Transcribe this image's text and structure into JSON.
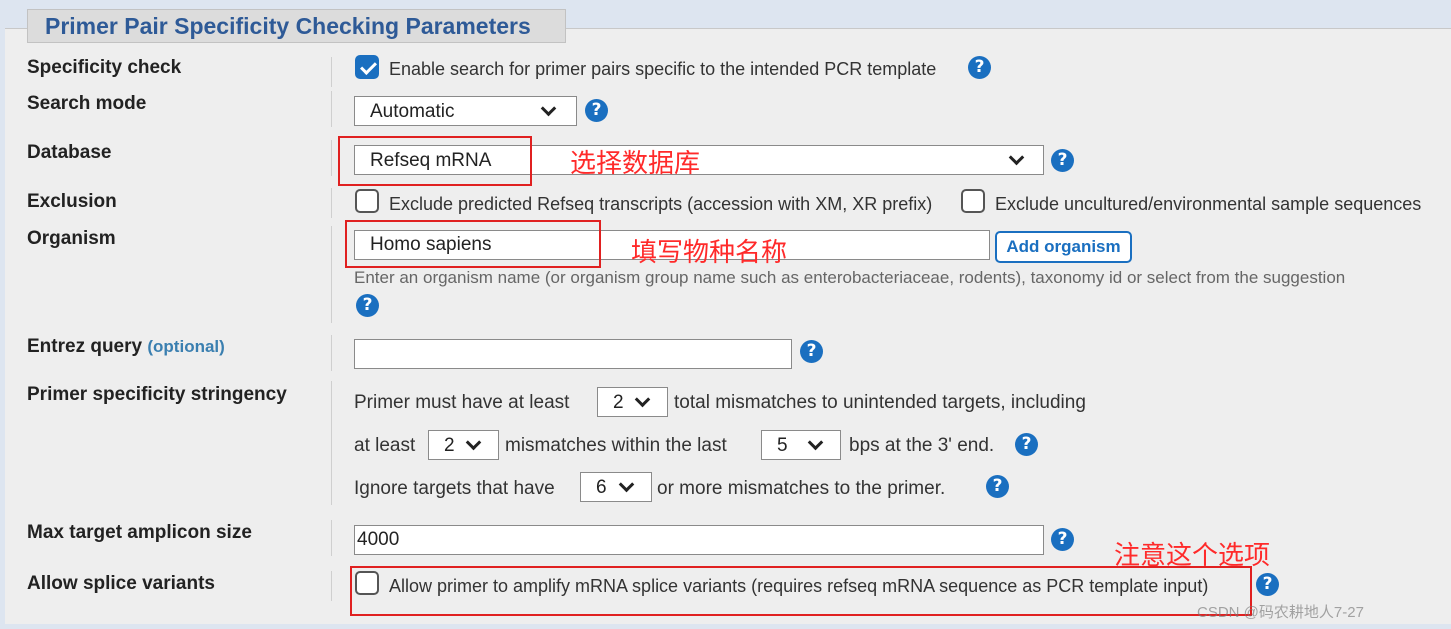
{
  "section_title": "Primer Pair Specificity Checking Parameters",
  "specificity": {
    "label": "Specificity check",
    "checked": true,
    "text": "Enable search for primer pairs specific to the intended PCR template"
  },
  "search_mode": {
    "label": "Search mode",
    "value": "Automatic"
  },
  "database": {
    "label": "Database",
    "value": "Refseq mRNA",
    "annotation": "选择数据库"
  },
  "exclusion": {
    "label": "Exclusion",
    "option1": "Exclude predicted Refseq transcripts (accession with XM, XR prefix)",
    "option1_checked": false,
    "option2": "Exclude uncultured/environmental sample sequences",
    "option2_checked": false
  },
  "organism": {
    "label": "Organism",
    "value": "Homo sapiens",
    "add_button": "Add organism",
    "hint": "Enter an organism name (or organism group name such as enterobacteriaceae, rodents), taxonomy id or select from the suggestion",
    "annotation": "填写物种名称"
  },
  "entrez": {
    "label": "Entrez query",
    "optional": "(optional)",
    "value": ""
  },
  "stringency": {
    "label": "Primer specificity stringency",
    "line1_pre": "Primer must have at least",
    "total_mismatches": "2",
    "line1_post": "total mismatches to unintended targets, including",
    "line2_pre": "at least",
    "mismatches": "2",
    "line2_mid": "mismatches within the last",
    "last_bps": "5",
    "line2_post": "bps at the 3' end.",
    "line3_pre": "Ignore targets that have",
    "ignore_mismatches": "6",
    "line3_post": "or more mismatches to the primer."
  },
  "max_amplicon": {
    "label": "Max target amplicon size",
    "value": "4000"
  },
  "splice": {
    "label": "Allow splice variants",
    "checked": false,
    "text": "Allow primer to amplify mRNA splice variants (requires refseq mRNA sequence as PCR template input)",
    "annotation": "注意这个选项"
  },
  "help_icon": "?",
  "watermark": "CSDN @码农耕地人7-27",
  "colors": {
    "accent": "#1a6fc0",
    "title": "#2e5a97",
    "annotation": "#e02020",
    "panel": "#eeeeee"
  }
}
